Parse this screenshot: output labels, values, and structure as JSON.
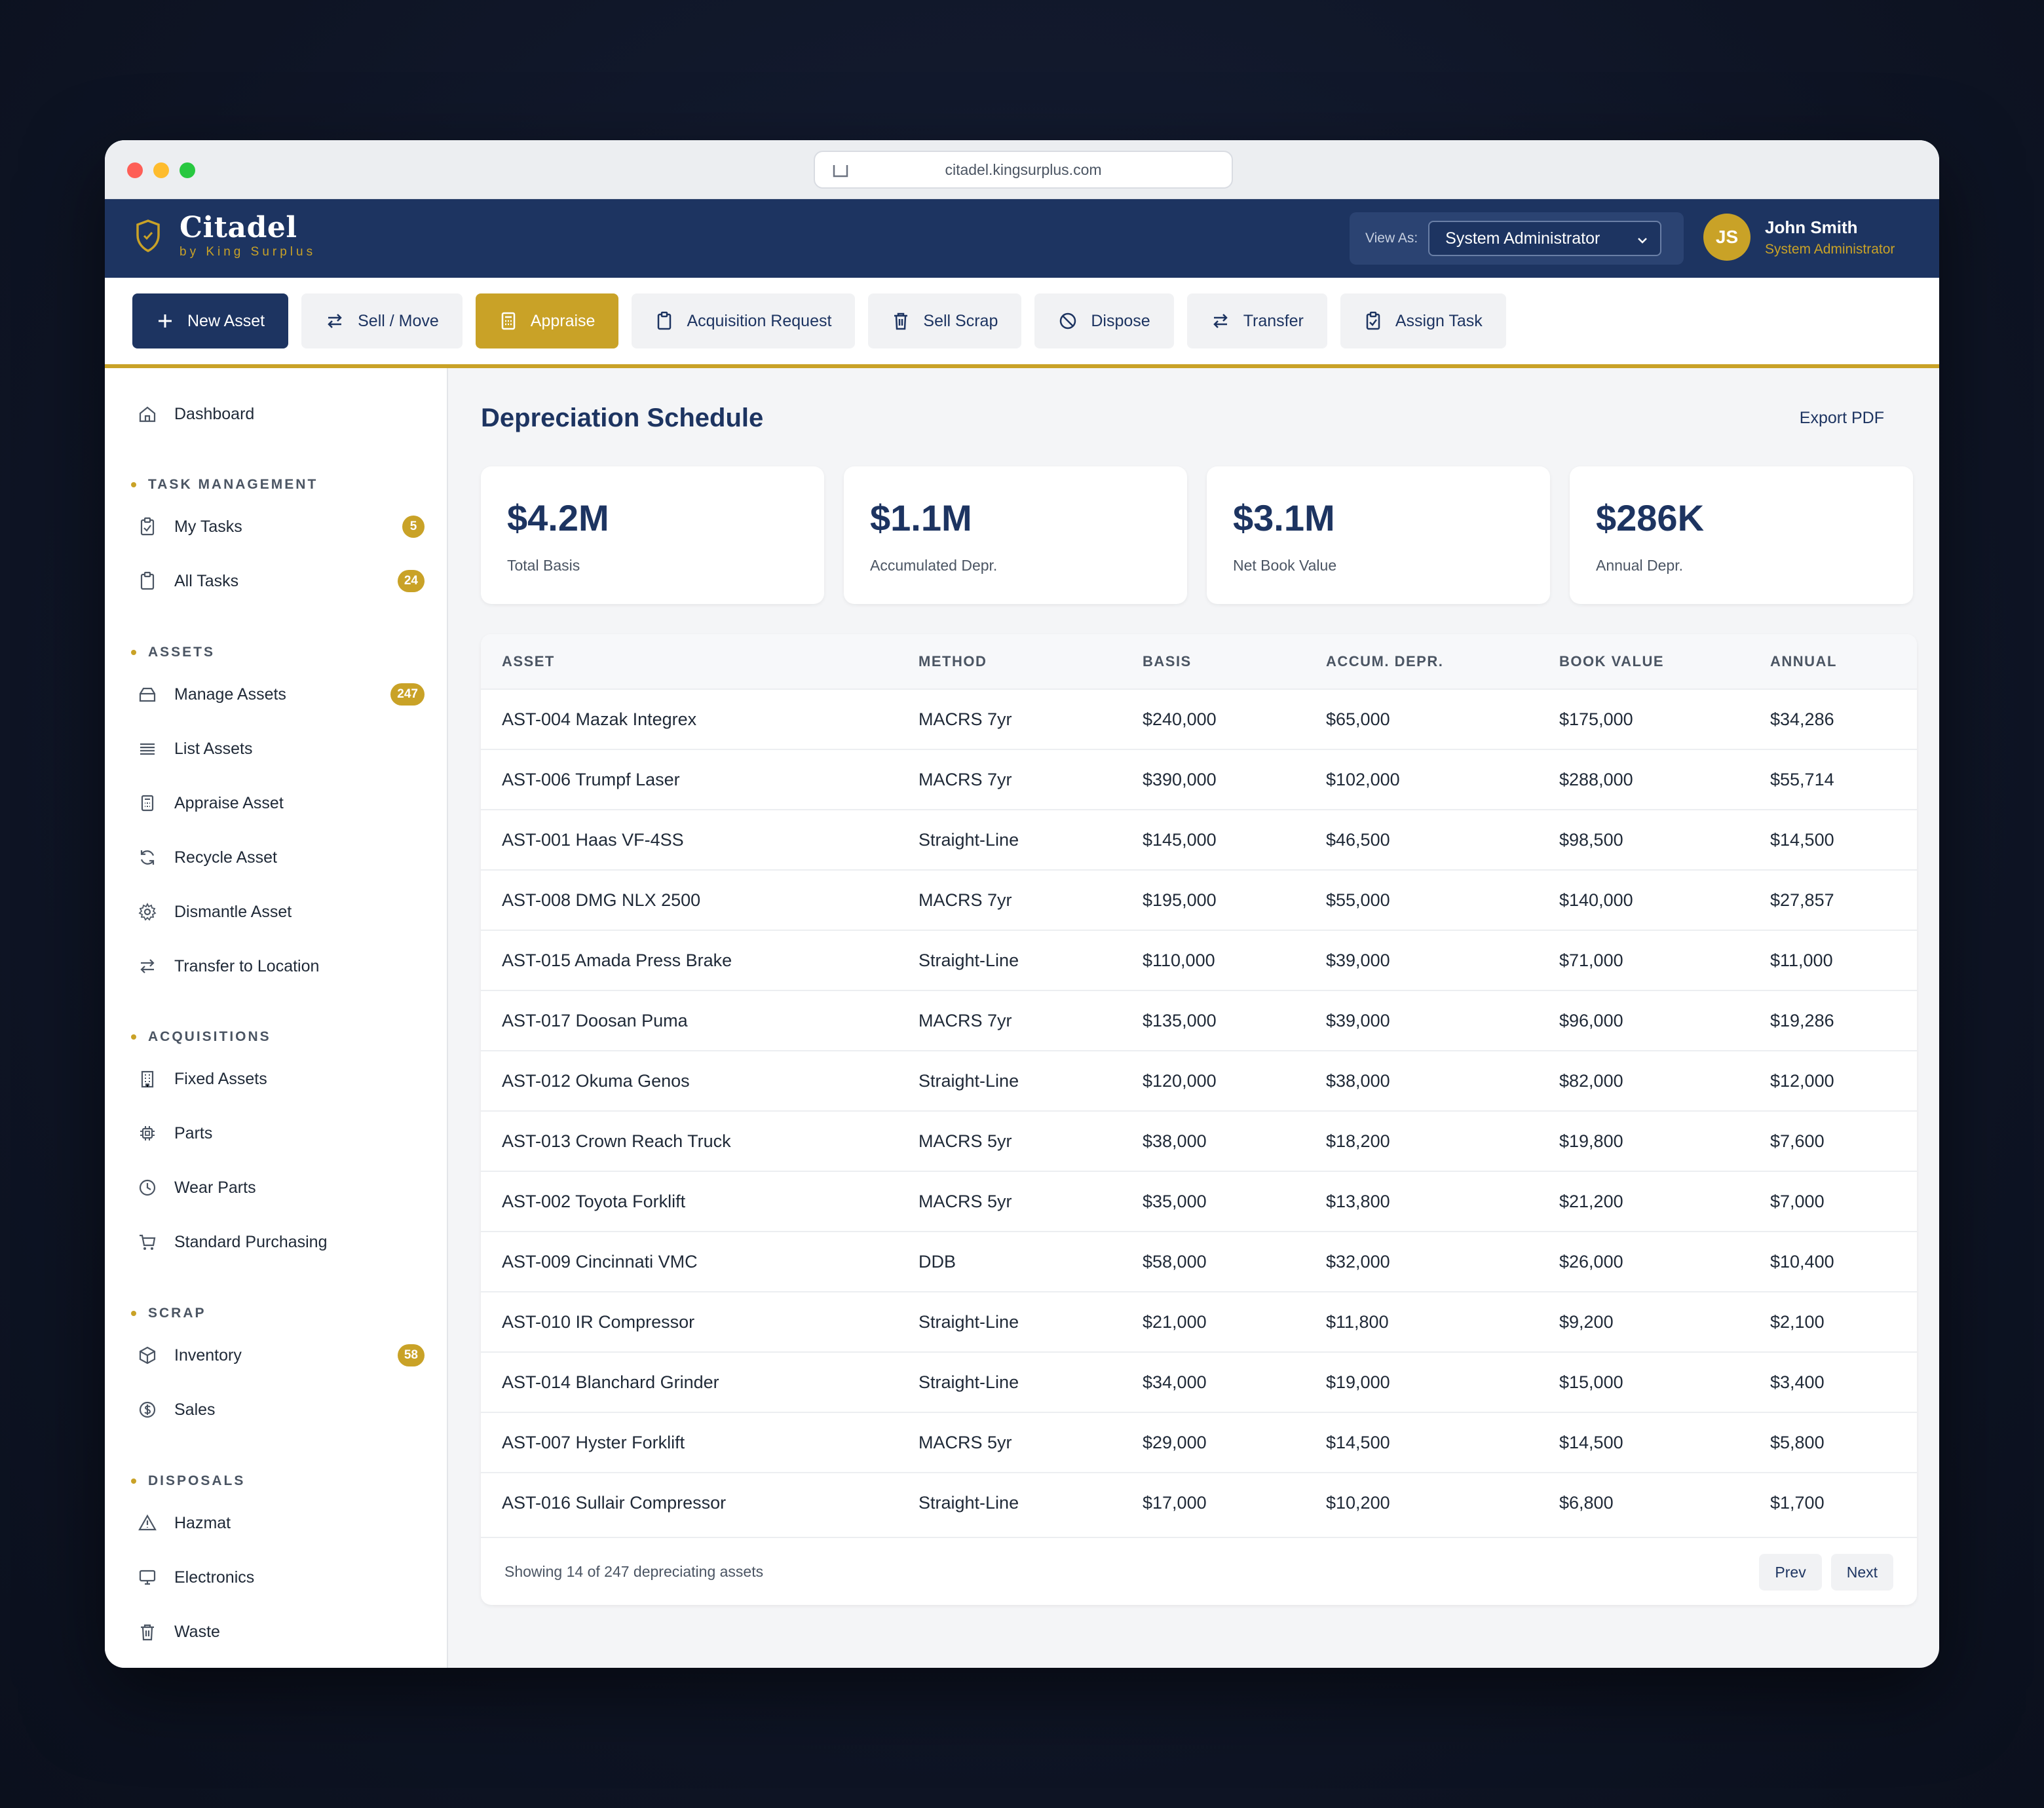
{
  "browser": {
    "url": "citadel.kingsurplus.com"
  },
  "brand": {
    "name": "Citadel",
    "subtitle": "by King Surplus"
  },
  "view_as": {
    "label": "View As:",
    "selected": "System Administrator"
  },
  "user": {
    "initials": "JS",
    "name": "John Smith",
    "role": "System Administrator"
  },
  "toolbar": {
    "new_asset": "New Asset",
    "sell_move": "Sell / Move",
    "appraise": "Appraise",
    "acquisition_request": "Acquisition Request",
    "sell_scrap": "Sell Scrap",
    "dispose": "Dispose",
    "transfer": "Transfer",
    "assign_task": "Assign Task"
  },
  "sidebar": {
    "dashboard": "Dashboard",
    "sections": {
      "task_management": "TASK MANAGEMENT",
      "assets": "ASSETS",
      "acquisitions": "ACQUISITIONS",
      "scrap": "SCRAP",
      "disposals": "DISPOSALS"
    },
    "items": {
      "my_tasks": {
        "label": "My Tasks",
        "badge": "5"
      },
      "all_tasks": {
        "label": "All Tasks",
        "badge": "24"
      },
      "manage_assets": {
        "label": "Manage Assets",
        "badge": "247"
      },
      "list_assets": {
        "label": "List Assets"
      },
      "appraise_asset": {
        "label": "Appraise Asset"
      },
      "recycle_asset": {
        "label": "Recycle Asset"
      },
      "dismantle_asset": {
        "label": "Dismantle Asset"
      },
      "transfer_location": {
        "label": "Transfer to Location"
      },
      "fixed_assets": {
        "label": "Fixed Assets"
      },
      "parts": {
        "label": "Parts"
      },
      "wear_parts": {
        "label": "Wear Parts"
      },
      "standard_purchasing": {
        "label": "Standard Purchasing"
      },
      "inventory": {
        "label": "Inventory",
        "badge": "58"
      },
      "sales": {
        "label": "Sales"
      },
      "hazmat": {
        "label": "Hazmat"
      },
      "electronics": {
        "label": "Electronics"
      },
      "waste": {
        "label": "Waste"
      }
    }
  },
  "main": {
    "title": "Depreciation Schedule",
    "export": "Export PDF",
    "stats": [
      {
        "value": "$4.2M",
        "label": "Total Basis"
      },
      {
        "value": "$1.1M",
        "label": "Accumulated Depr."
      },
      {
        "value": "$3.1M",
        "label": "Net Book Value"
      },
      {
        "value": "$286K",
        "label": "Annual Depr."
      }
    ],
    "table": {
      "headers": [
        "ASSET",
        "METHOD",
        "BASIS",
        "ACCUM. DEPR.",
        "BOOK VALUE",
        "ANNUAL"
      ],
      "rows": [
        [
          "AST-004 Mazak Integrex",
          "MACRS 7yr",
          "$240,000",
          "$65,000",
          "$175,000",
          "$34,286"
        ],
        [
          "AST-006 Trumpf Laser",
          "MACRS 7yr",
          "$390,000",
          "$102,000",
          "$288,000",
          "$55,714"
        ],
        [
          "AST-001 Haas VF-4SS",
          "Straight-Line",
          "$145,000",
          "$46,500",
          "$98,500",
          "$14,500"
        ],
        [
          "AST-008 DMG NLX 2500",
          "MACRS 7yr",
          "$195,000",
          "$55,000",
          "$140,000",
          "$27,857"
        ],
        [
          "AST-015 Amada Press Brake",
          "Straight-Line",
          "$110,000",
          "$39,000",
          "$71,000",
          "$11,000"
        ],
        [
          "AST-017 Doosan Puma",
          "MACRS 7yr",
          "$135,000",
          "$39,000",
          "$96,000",
          "$19,286"
        ],
        [
          "AST-012 Okuma Genos",
          "Straight-Line",
          "$120,000",
          "$38,000",
          "$82,000",
          "$12,000"
        ],
        [
          "AST-013 Crown Reach Truck",
          "MACRS 5yr",
          "$38,000",
          "$18,200",
          "$19,800",
          "$7,600"
        ],
        [
          "AST-002 Toyota Forklift",
          "MACRS 5yr",
          "$35,000",
          "$13,800",
          "$21,200",
          "$7,000"
        ],
        [
          "AST-009 Cincinnati VMC",
          "DDB",
          "$58,000",
          "$32,000",
          "$26,000",
          "$10,400"
        ],
        [
          "AST-010 IR Compressor",
          "Straight-Line",
          "$21,000",
          "$11,800",
          "$9,200",
          "$2,100"
        ],
        [
          "AST-014 Blanchard Grinder",
          "Straight-Line",
          "$34,000",
          "$19,000",
          "$15,000",
          "$3,400"
        ],
        [
          "AST-007 Hyster Forklift",
          "MACRS 5yr",
          "$29,000",
          "$14,500",
          "$14,500",
          "$5,800"
        ],
        [
          "AST-016 Sullair Compressor",
          "Straight-Line",
          "$17,000",
          "$10,200",
          "$6,800",
          "$1,700"
        ]
      ],
      "footer": "Showing 14 of 247 depreciating assets",
      "prev": "Prev",
      "next": "Next"
    }
  },
  "colors": {
    "navy": "#1d3461",
    "gold": "#c9a227",
    "background": "#f4f5f7"
  }
}
